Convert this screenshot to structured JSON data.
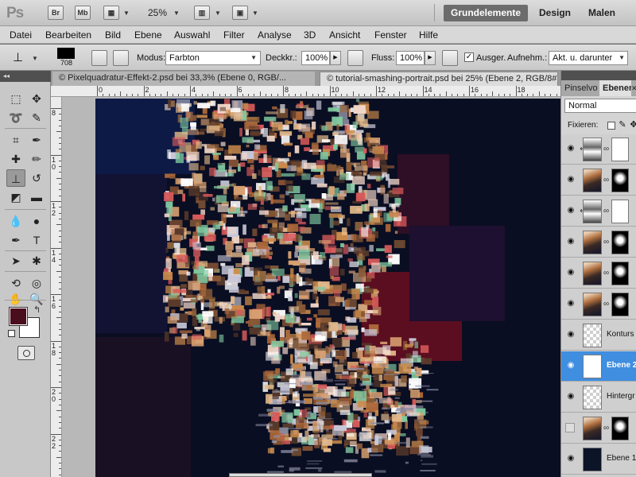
{
  "app": {
    "logo": "Ps",
    "bridge_label": "Br",
    "minibridge_label": "Mb",
    "zoom": "25%",
    "workspaces": [
      "Grundelemente",
      "Design",
      "Malen"
    ]
  },
  "menu": [
    "Datei",
    "Bearbeiten",
    "Bild",
    "Ebene",
    "Auswahl",
    "Filter",
    "Analyse",
    "3D",
    "Ansicht",
    "Fenster",
    "Hilfe"
  ],
  "options": {
    "brush_size": "708",
    "mode_label": "Modus:",
    "mode_value": "Farbton",
    "opacity_label": "Deckkr.:",
    "opacity_value": "100%",
    "flow_label": "Fluss:",
    "flow_value": "100%",
    "aligned_label": "Ausger.",
    "aligned_checked": true,
    "sample_label": "Aufnehm.:",
    "sample_value": "Akt. u. darunter"
  },
  "tabs": [
    {
      "label": "© Pixelquadratur-Effekt-2.psd bei 33,3% (Ebene 0, RGB/..."
    },
    {
      "label": "© tutorial-smashing-portrait.psd bei 25% (Ebene 2, RGB/8#) *"
    }
  ],
  "ruler_top": [
    "0",
    "2",
    "4",
    "6",
    "8",
    "10",
    "12",
    "14",
    "16",
    "18"
  ],
  "ruler_left": [
    "8",
    "1\n0",
    "1\n2",
    "1\n4",
    "1\n6",
    "1\n8",
    "2\n0",
    "2\n2"
  ],
  "colors": {
    "foreground": "#4a0d1e",
    "background": "#ffffff",
    "accent_selected": "#3f8ee0"
  },
  "panels": {
    "tabs": [
      "Pinselvo",
      "Ebenen"
    ],
    "close": "✕",
    "blend_mode": "Normal",
    "lock_label": "Fixieren:",
    "layers": [
      {
        "name": "",
        "thumb": "grad",
        "mask": "white",
        "clipped": true,
        "visible": true
      },
      {
        "name": "",
        "thumb": "photo",
        "mask": "bw",
        "visible": true
      },
      {
        "name": "",
        "thumb": "grad",
        "mask": "white",
        "clipped": true,
        "visible": true
      },
      {
        "name": "",
        "thumb": "photo",
        "mask": "bw",
        "visible": true
      },
      {
        "name": "",
        "thumb": "photo",
        "mask": "bw",
        "visible": true
      },
      {
        "name": "",
        "thumb": "photo",
        "mask": "bw",
        "visible": true
      },
      {
        "name": "Konturs",
        "thumb": "checker",
        "visible": true
      },
      {
        "name": "Ebene 2",
        "thumb": "ebene2",
        "visible": true,
        "selected": true
      },
      {
        "name": "Hintergr",
        "thumb": "checker",
        "visible": true
      },
      {
        "name": "",
        "thumb": "photo",
        "mask": "bw",
        "visible": false
      },
      {
        "name": "Ebene 1",
        "thumb": "dark",
        "visible": true
      }
    ]
  },
  "tools": [
    "marquee-tool",
    "move-tool",
    "lasso-tool",
    "quick-select-tool",
    "crop-tool",
    "eyedropper-tool",
    "healing-tool",
    "brush-tool",
    "clone-stamp-tool",
    "history-brush-tool",
    "eraser-tool",
    "gradient-tool",
    "blur-tool",
    "dodge-tool",
    "pen-tool",
    "type-tool",
    "path-select-tool",
    "shape-tool",
    "3d-rotate-tool",
    "3d-orbit-tool",
    "hand-tool",
    "zoom-tool"
  ]
}
